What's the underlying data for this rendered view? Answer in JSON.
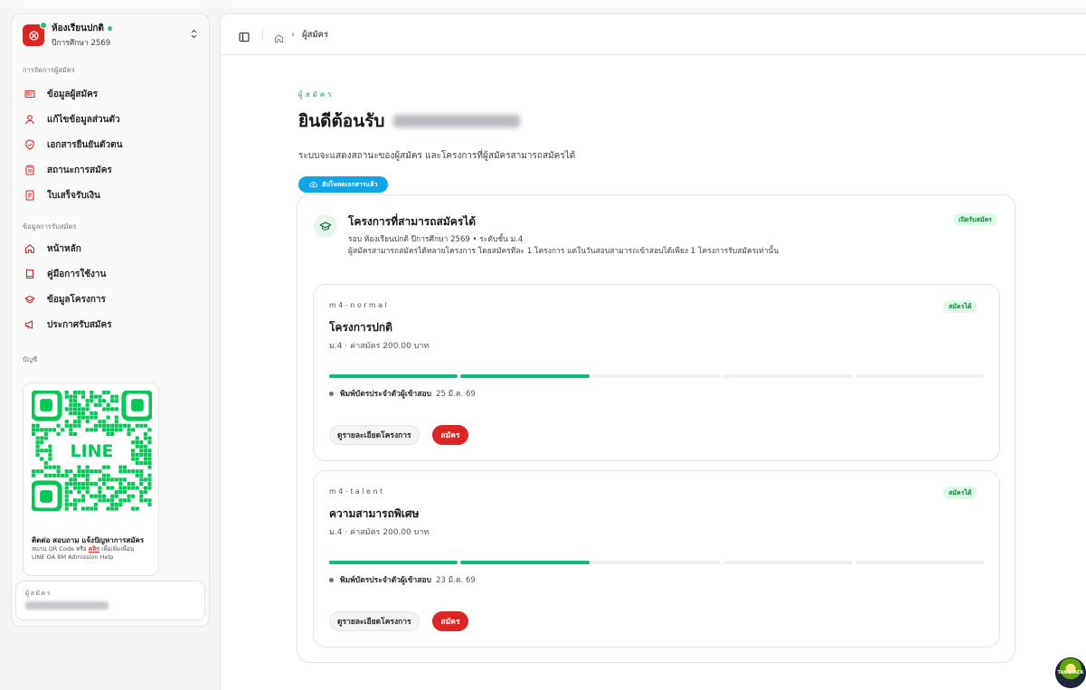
{
  "sidebar": {
    "org_name": "ห้องเรียนปกติ",
    "org_year": "ปีการศึกษา 2569",
    "group_manage": "การจัดการผู้สมัคร",
    "group_info": "ข้อมูลการรับสมัคร",
    "group_account": "บัญชี",
    "manage_items": [
      {
        "label": "ข้อมูลผู้สมัคร",
        "icon": "id-card-icon"
      },
      {
        "label": "แก้ไขข้อมูลส่วนตัว",
        "icon": "user-icon"
      },
      {
        "label": "เอกสารยืนยันตัวตน",
        "icon": "shield-check-icon"
      },
      {
        "label": "สถานะการสมัคร",
        "icon": "clipboard-icon"
      },
      {
        "label": "ใบเสร็จรับเงิน",
        "icon": "receipt-icon"
      }
    ],
    "info_items": [
      {
        "label": "หน้าหลัก",
        "icon": "home-icon"
      },
      {
        "label": "คู่มือการใช้งาน",
        "icon": "book-icon"
      },
      {
        "label": "ข้อมูลโครงการ",
        "icon": "graduation-cap-icon"
      },
      {
        "label": "ประกาศรับสมัคร",
        "icon": "megaphone-icon"
      }
    ],
    "qr": {
      "center_text": "LINE",
      "title": "ติดต่อ สอบถาม แจ้งปัญหาการสมัคร",
      "desc_prefix": "สแกน QR Code หรือ ",
      "desc_link": "คลิก",
      "desc_suffix": " เพื่อเพิ่มเพื่อน",
      "desc_line2": "LINE OA BM Admission Help"
    },
    "user_label": "ผู้สมัคร"
  },
  "topbar": {
    "breadcrumb_current": "ผู้สมัคร"
  },
  "main": {
    "eyebrow": "ผู้สมัคร",
    "greeting": "ยินดีต้อนรับ",
    "intro": "ระบบจะแสดงสถานะของผู้สมัคร และโครงการที่ผู้สมัครสามารถสมัครได้",
    "upload_button": "อัปโหลดเอกสารแล้ว",
    "programs_card": {
      "title": "โครงการที่สามารถสมัครได้",
      "badge": "เปิดรับสมัคร",
      "subtitle1": "รอบ ห้องเรียนปกติ ปีการศึกษา 2569 • ระดับชั้น ม.4",
      "subtitle2": "ผู้สมัครสามารถสมัครได้หลายโครงการ โดยสมัครทีละ 1 โครงการ แต่ในวันสอบสามารถเข้าสอบได้เพียง 1 โครงการรับสมัครเท่านั้น"
    },
    "programs": [
      {
        "code": "m4-normal",
        "name": "โครงการปกติ",
        "price": "ม.4 · ค่าสมัคร 200.00 บาท",
        "badge": "สมัครได้",
        "print_label": "พิมพ์บัตรประจำตัวผู้เข้าสอบ",
        "print_date": "25 มี.ค. 69",
        "steps_total": 5,
        "steps_done": 2,
        "detail_button": "ดูรายละเอียดโครงการ",
        "apply_button": "สมัคร"
      },
      {
        "code": "m4-talent",
        "name": "ความสามารถพิเศษ",
        "price": "ม.4 · ค่าสมัคร 200.00 บาท",
        "badge": "สมัครได้",
        "print_label": "พิมพ์บัตรประจำตัวผู้เข้าสอบ",
        "print_date": "23 มี.ค. 69",
        "steps_total": 5,
        "steps_done": 2,
        "detail_button": "ดูรายละเอียดโครงการ",
        "apply_button": "สมัคร"
      }
    ]
  },
  "corner_badge": "TANSTACK",
  "colors": {
    "brand_red": "#dc2626",
    "success_green": "#10b981",
    "line_green": "#06c755",
    "upload_blue": "#0ea5e9"
  }
}
